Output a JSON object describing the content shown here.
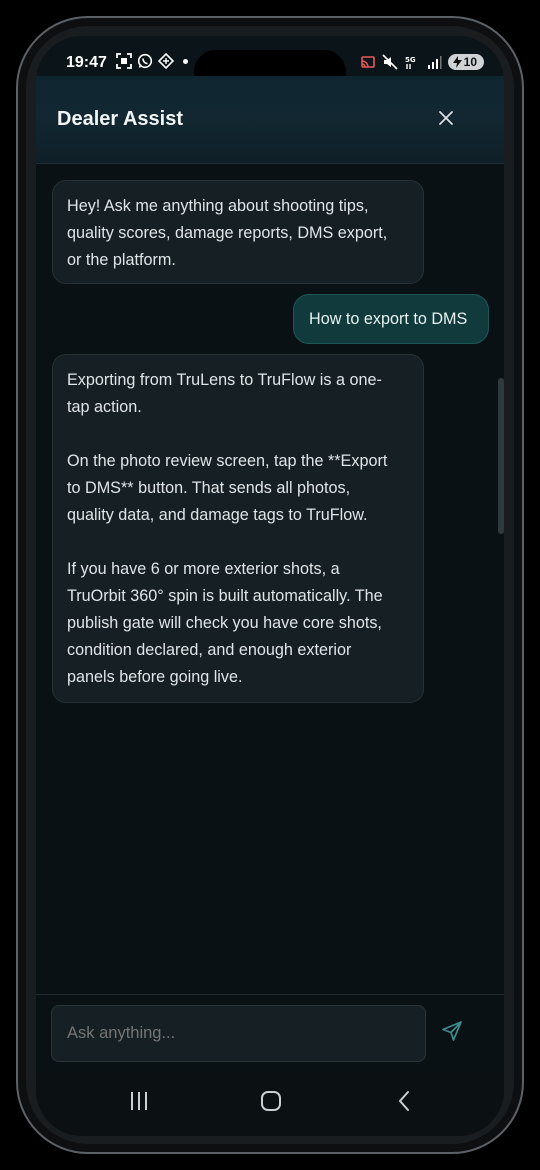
{
  "status_bar": {
    "time": "19:47",
    "battery": "10",
    "left_icons": [
      "screenshot-icon",
      "whatsapp-icon",
      "app-icon"
    ],
    "right_icons": [
      "cast-icon",
      "mute-icon",
      "5g-icon",
      "signal-icon",
      "battery-icon"
    ]
  },
  "header": {
    "title": "Dealer Assist",
    "close_icon": "close-icon"
  },
  "messages": [
    {
      "role": "assistant",
      "lines": [
        "Hey! Ask me anything about shooting tips,",
        "quality scores, damage reports, DMS export,",
        "or the platform."
      ]
    },
    {
      "role": "user",
      "text": "How to export to DMS"
    },
    {
      "role": "assistant",
      "lines": [
        "Exporting from TruLens to TruFlow is a one-",
        "tap action.",
        "",
        "On the photo review screen, tap the **Export",
        "to DMS** button. That sends all photos,",
        "quality data, and damage tags to TruFlow.",
        "",
        "If you have 6 or more exterior shots, a",
        "TruOrbit 360° spin is built automatically. The",
        "publish gate will check you have core shots,",
        "condition declared, and enough exterior",
        "panels before going live."
      ]
    }
  ],
  "composer": {
    "placeholder": "Ask anything...",
    "send_icon": "send-icon"
  },
  "nav_bar": {
    "buttons": [
      "recents-icon",
      "home-icon",
      "back-icon"
    ]
  },
  "colors": {
    "background": "#0a1114",
    "header": "#122731",
    "bot_bubble": "#161f23",
    "user_bubble": "#103a3c",
    "accent": "#4aa3a6"
  }
}
